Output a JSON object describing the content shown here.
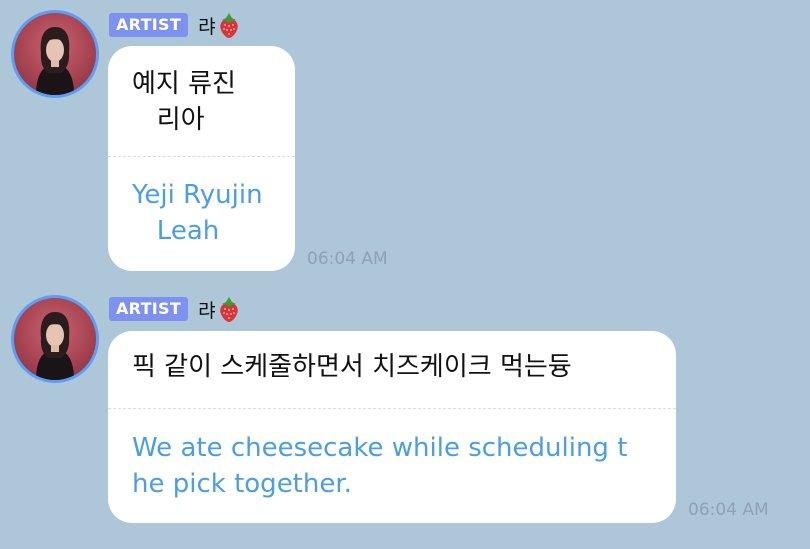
{
  "messages": [
    {
      "badge": "ARTIST",
      "sender": "랴",
      "original_lines": [
        "예지 류진",
        "   리아"
      ],
      "translation_lines": [
        "Yeji Ryujin",
        "   Leah"
      ],
      "time": "06:04 AM"
    },
    {
      "badge": "ARTIST",
      "sender": "랴",
      "original_lines": [
        "픽 같이 스케줄하면서 치즈케이크 먹는듕"
      ],
      "translation_lines": [
        "We ate cheesecake while scheduling t",
        "he pick together."
      ],
      "time": "06:04 AM"
    }
  ],
  "colors": {
    "background": "#adc7d9",
    "badge": "#7c91f0",
    "translation_text": "#4b9ee0",
    "avatar_ring": "#5c9ef5"
  },
  "icons": [
    "strawberry-emoji",
    "avatar-photo"
  ]
}
